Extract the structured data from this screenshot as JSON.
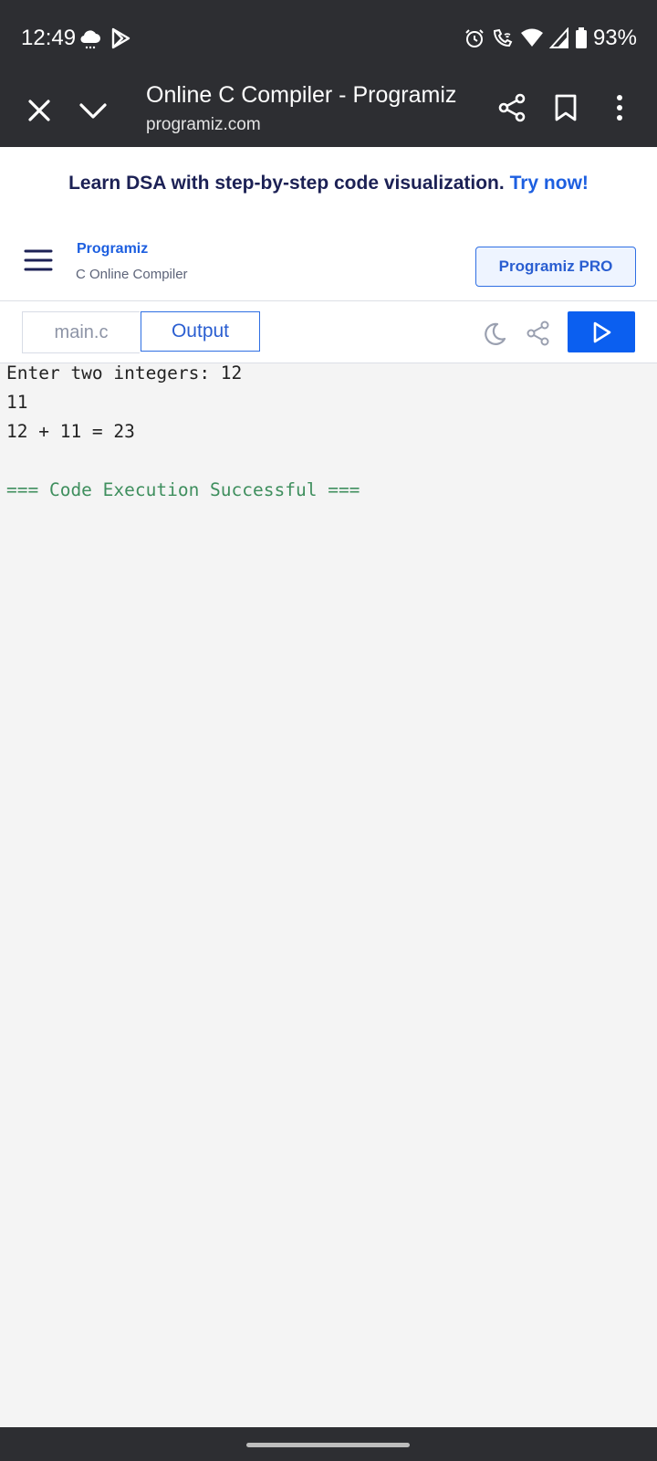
{
  "status_bar": {
    "time": "12:49",
    "battery": "93%"
  },
  "browser": {
    "title": "Online C Compiler - Programiz",
    "url": "programiz.com"
  },
  "promo": {
    "text": "Learn DSA with step-by-step code visualization.",
    "link": "Try now!"
  },
  "site_header": {
    "brand": "Programiz",
    "subtitle": "C Online Compiler",
    "pro_button": "Programiz PRO"
  },
  "tabs": {
    "file": "main.c",
    "output": "Output"
  },
  "output": {
    "lines": [
      "Enter two integers: 12",
      "11",
      "12 + 11 = 23",
      "",
      "=== Code Execution Successful ==="
    ]
  },
  "colors": {
    "accent": "#0b5ff0",
    "header_bg": "#2d2e32",
    "success": "#3f8f5e"
  }
}
